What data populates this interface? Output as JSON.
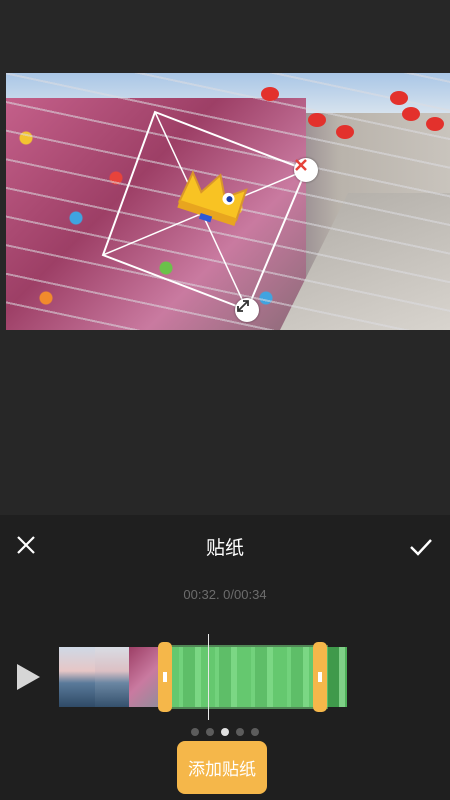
{
  "editor": {
    "title": "贴纸",
    "time_readout": "00:32. 0/00:34",
    "add_sticker_label": "添加贴纸",
    "close_icon": "close-icon",
    "confirm_icon": "checkmark-icon",
    "play_icon": "play-icon"
  },
  "sticker": {
    "name": "crown-sticker",
    "delete_icon": "close-icon",
    "scale_icon": "resize-rotate-icon"
  },
  "page_indicator": {
    "count": 5,
    "active_index": 2
  },
  "colors": {
    "accent": "#f5b74a",
    "panel_bg": "#1f1f1f",
    "preview_bg": "#272727",
    "selection": "#7bd887",
    "delete_handle": "#e5423a"
  }
}
